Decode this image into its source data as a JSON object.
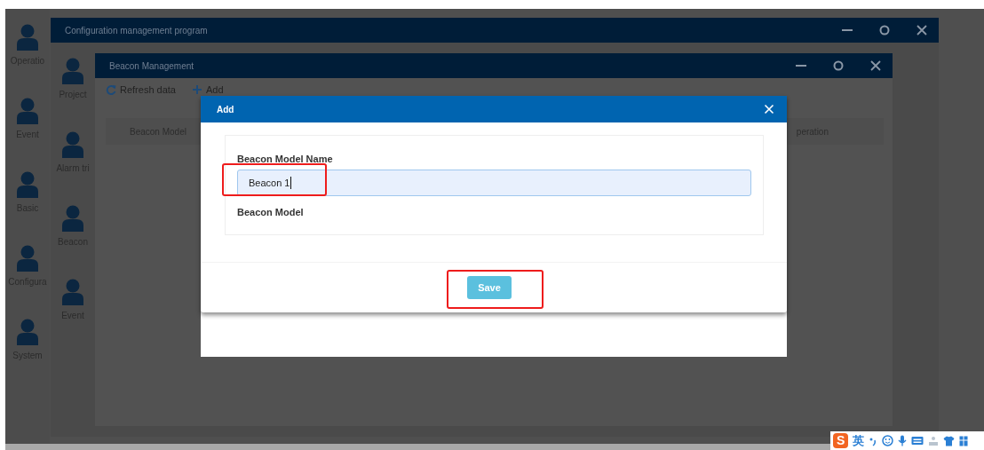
{
  "sidebar": {
    "items": [
      {
        "label": "Operatio"
      },
      {
        "label": "Event"
      },
      {
        "label": "Basic"
      },
      {
        "label": "Configura"
      },
      {
        "label": "System"
      }
    ]
  },
  "main_window": {
    "title": "Configuration management program",
    "nav": [
      {
        "label": "Project"
      },
      {
        "label": "Alarm tri"
      },
      {
        "label": "Beacon"
      },
      {
        "label": "Event"
      }
    ],
    "child_window": {
      "title": "Beacon Management",
      "toolbar": [
        {
          "kind": "refresh",
          "label": "Refresh data"
        },
        {
          "kind": "add",
          "label": "Add"
        }
      ],
      "table": {
        "columns": [
          {
            "label": "Beacon Model"
          },
          {
            "label": "peration"
          }
        ]
      }
    }
  },
  "dialog": {
    "title": "Add",
    "fields": [
      {
        "label": "Beacon Model Name",
        "value": "Beacon 1",
        "focused": true
      },
      {
        "label": "Beacon Model"
      }
    ],
    "buttons": [
      "Save"
    ]
  },
  "ime": {
    "logo": "S",
    "mode": "英"
  }
}
